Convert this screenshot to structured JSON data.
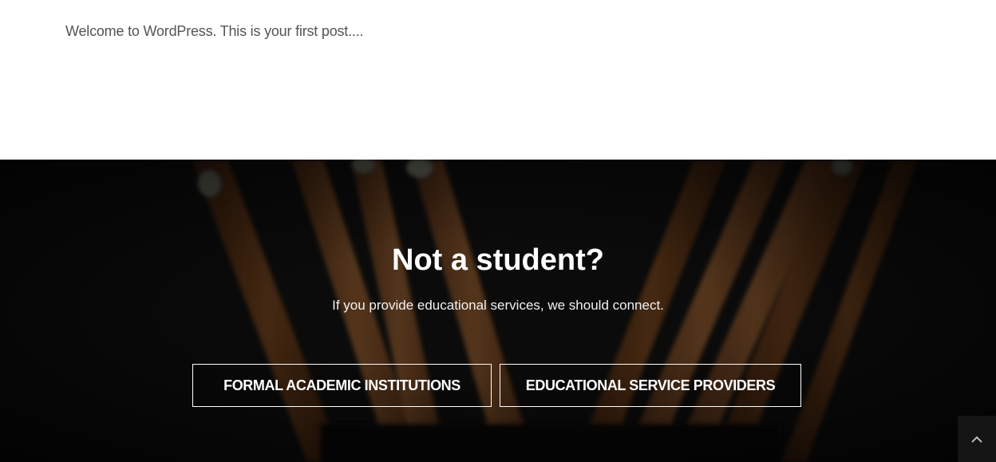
{
  "post": {
    "excerpt": "Welcome to WordPress. This is your first post...."
  },
  "cta": {
    "title": "Not a student?",
    "subtitle": "If you provide educational services, we should connect.",
    "buttons": [
      {
        "label": "FORMAL ACADEMIC INSTITUTIONS"
      },
      {
        "label": "EDUCATIONAL SERVICE PROVIDERS"
      }
    ]
  },
  "back_to_top": {
    "icon": "chevron-up-icon"
  },
  "colors": {
    "background_dark": "#0c0c0c",
    "text_light": "#ffffff",
    "excerpt_text": "#555555"
  }
}
